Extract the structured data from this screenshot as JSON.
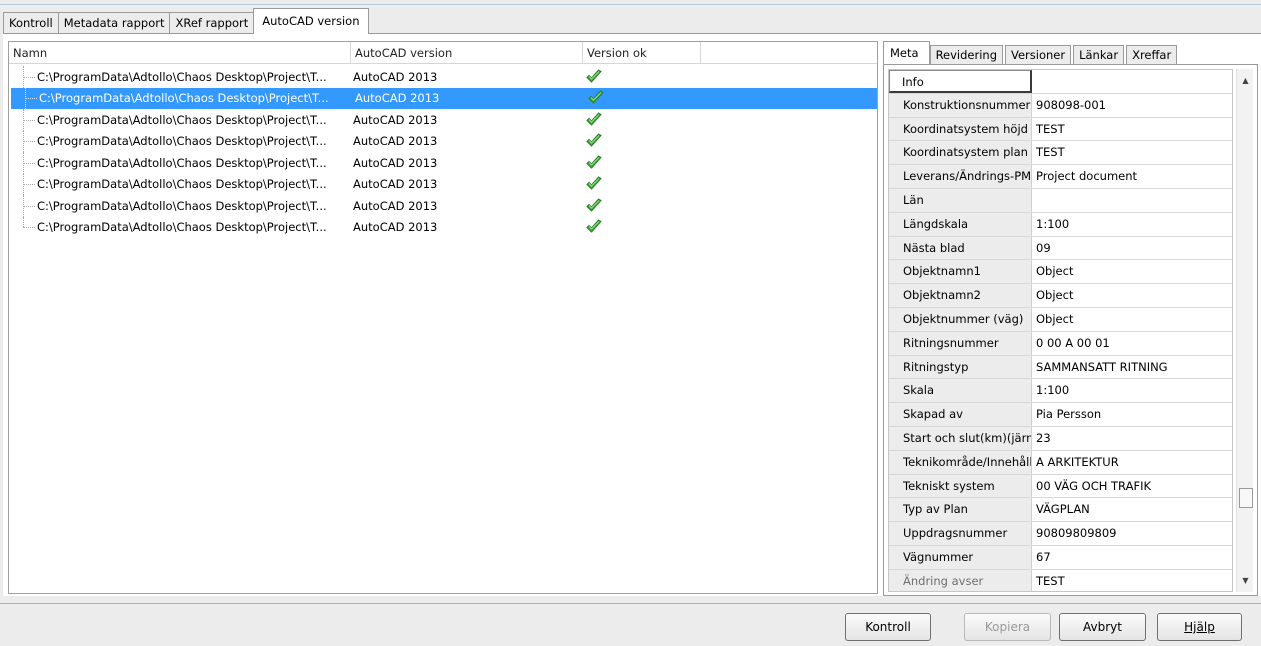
{
  "top_tabs": [
    "Kontroll",
    "Metadata rapport",
    "XRef rapport",
    "AutoCAD version"
  ],
  "list": {
    "columns": [
      "Namn",
      "AutoCAD version",
      "Version ok"
    ],
    "rows": [
      {
        "name": "C:\\ProgramData\\Adtollo\\Chaos Desktop\\Project\\T...",
        "version": "AutoCAD 2013",
        "ok": "check-icon"
      },
      {
        "name": "C:\\ProgramData\\Adtollo\\Chaos Desktop\\Project\\T...",
        "version": "AutoCAD 2013",
        "ok": "check-icon"
      },
      {
        "name": "C:\\ProgramData\\Adtollo\\Chaos Desktop\\Project\\T...",
        "version": "AutoCAD 2013",
        "ok": "check-icon"
      },
      {
        "name": "C:\\ProgramData\\Adtollo\\Chaos Desktop\\Project\\T...",
        "version": "AutoCAD 2013",
        "ok": "check-icon"
      },
      {
        "name": "C:\\ProgramData\\Adtollo\\Chaos Desktop\\Project\\T...",
        "version": "AutoCAD 2013",
        "ok": "check-icon"
      },
      {
        "name": "C:\\ProgramData\\Adtollo\\Chaos Desktop\\Project\\T...",
        "version": "AutoCAD 2013",
        "ok": "check-icon"
      },
      {
        "name": "C:\\ProgramData\\Adtollo\\Chaos Desktop\\Project\\T...",
        "version": "AutoCAD 2013",
        "ok": "check-icon"
      },
      {
        "name": "C:\\ProgramData\\Adtollo\\Chaos Desktop\\Project\\T...",
        "version": "AutoCAD 2013",
        "ok": "check-icon"
      }
    ],
    "selected_index": 1
  },
  "right_tabs": [
    "Meta",
    "Revidering",
    "Versioner",
    "Länkar",
    "Xreffar"
  ],
  "properties": [
    {
      "name": "Info",
      "value": ""
    },
    {
      "name": "Konstruktionsnummer",
      "value": "908098-001"
    },
    {
      "name": "Koordinatsystem höjd",
      "value": "TEST"
    },
    {
      "name": "Koordinatsystem plan",
      "value": "TEST"
    },
    {
      "name": "Leverans/Ändrings-PM",
      "value": "Project document"
    },
    {
      "name": "Län",
      "value": ""
    },
    {
      "name": "Längdskala",
      "value": "1:100"
    },
    {
      "name": "Nästa blad",
      "value": "09"
    },
    {
      "name": "Objektnamn1",
      "value": "Object"
    },
    {
      "name": "Objektnamn2",
      "value": "Object"
    },
    {
      "name": "Objektnummer (väg)",
      "value": "Object"
    },
    {
      "name": "Ritningsnummer",
      "value": "0 00 A 00 01"
    },
    {
      "name": "Ritningstyp",
      "value": "SAMMANSATT RITNING"
    },
    {
      "name": "Skala",
      "value": "1:100"
    },
    {
      "name": "Skapad av",
      "value": "Pia Persson"
    },
    {
      "name": "Start och slut(km)(järn",
      "value": "23"
    },
    {
      "name": "Teknikområde/Innehåll",
      "value": "A ARKITEKTUR"
    },
    {
      "name": "Tekniskt system",
      "value": "00 VÄG OCH TRAFIK"
    },
    {
      "name": "Typ av Plan",
      "value": "VÄGPLAN"
    },
    {
      "name": "Uppdragsnummer",
      "value": "90809809809"
    },
    {
      "name": "Vägnummer",
      "value": "67"
    },
    {
      "name": "Ändring avser",
      "value": "TEST"
    }
  ],
  "buttons": {
    "kontroll": "Kontroll",
    "kopiera": "Kopiera",
    "avbryt": "Avbryt",
    "hjalp": "Hjälp"
  },
  "colors": {
    "selection": "#3399ff",
    "check": "#3da63a"
  }
}
